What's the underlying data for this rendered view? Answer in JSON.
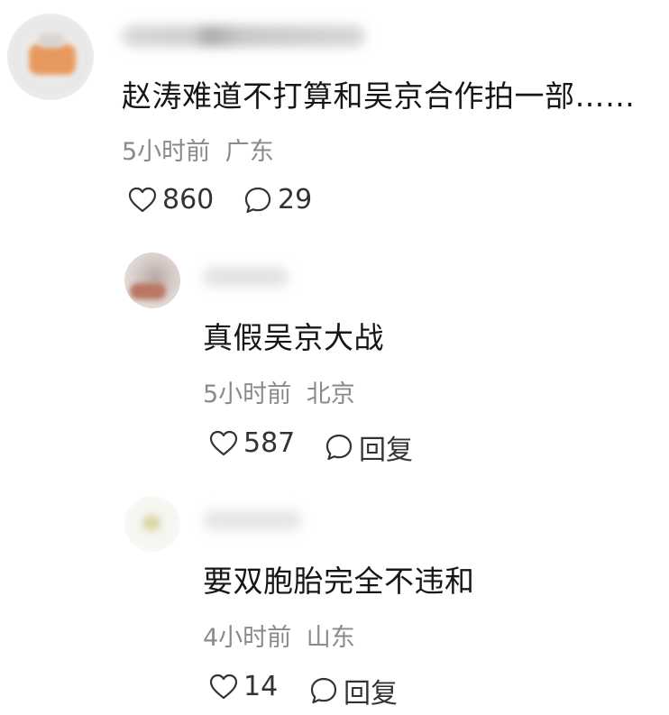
{
  "comments": [
    {
      "text": "赵涛难道不打算和吴京合作拍一部……",
      "time": "5小时前",
      "location": "广东",
      "likes": "860",
      "replies": "29"
    },
    {
      "text": "真假吴京大战",
      "time": "5小时前",
      "location": "北京",
      "likes": "587",
      "reply_label": "回复"
    },
    {
      "text": "要双胞胎完全不违和",
      "time": "4小时前",
      "location": "山东",
      "likes": "14",
      "reply_label": "回复"
    }
  ]
}
